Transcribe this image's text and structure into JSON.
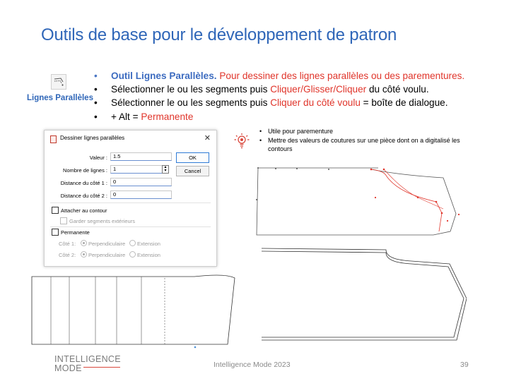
{
  "slide": {
    "title": "Outils de base pour le développement de patron",
    "tool_label": "Lignes Parallèles",
    "bullets": {
      "b1_bold": "Outil Lignes Parallèles.",
      "b1_red": " Pour dessiner des lignes parallèles ou des parementures.",
      "b2_text": "Sélectionner le ou les segments puis ",
      "b2_red": "Cliquer/Glisser/Cliquer",
      "b2_end": " du côté voulu.",
      "b3_text": "Sélectionner le ou les segments puis ",
      "b3_red": "Cliquer du côté voulu",
      "b3_end": " = boîte de dialogue.",
      "b4_text": "+ Alt = ",
      "b4_red": "Permanente"
    },
    "tips": [
      "Utile pour parementure",
      "Mettre des valeurs de coutures sur une pièce dont on a digitalisé les contours"
    ],
    "footer": "Intelligence Mode 2023",
    "page_number": "39",
    "logo": {
      "top": "INTELLIGENCE",
      "bottom": "MODE"
    }
  },
  "dialog": {
    "title": "Dessiner lignes parallèles",
    "close_glyph": "✕",
    "fields": {
      "valeur_label": "Valeur :",
      "valeur_value": "1.5",
      "nombre_label": "Nombre de lignes :",
      "nombre_value": "1",
      "distance1_label": "Distance du côté 1 :",
      "distance1_value": "0",
      "distance2_label": "Distance du côté 2 :",
      "distance2_value": "0"
    },
    "buttons": {
      "ok": "OK",
      "cancel": "Cancel"
    },
    "attacher": "Attacher au contour",
    "garder": "Garder segments extérieurs",
    "permanente": "Permanente",
    "cote1_label": "Côté 1:",
    "cote2_label": "Côté 2:",
    "perpendiculaire": "Perpendiculaire",
    "extension": "Extension"
  },
  "colors": {
    "title_blue": "#2f66b8",
    "accent_red": "#e0352b"
  },
  "icons": {
    "tool": "parallel-lines-tool-icon",
    "tip": "lightbulb-icon"
  }
}
